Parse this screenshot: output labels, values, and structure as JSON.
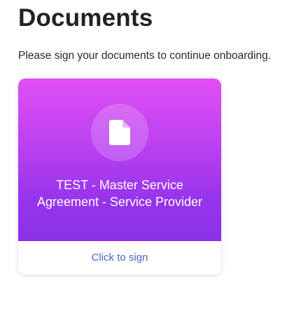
{
  "page": {
    "title": "Documents",
    "subtitle": "Please sign your documents to continue onboarding."
  },
  "documents": [
    {
      "name": "TEST - Master Service Agreement - Service Provider",
      "icon": "document-icon",
      "action_label": "Click to sign"
    }
  ],
  "colors": {
    "card_gradient_top": "#e14ff5",
    "card_gradient_bottom": "#8c31ea",
    "link": "#4a63c8",
    "heading": "#222222"
  }
}
